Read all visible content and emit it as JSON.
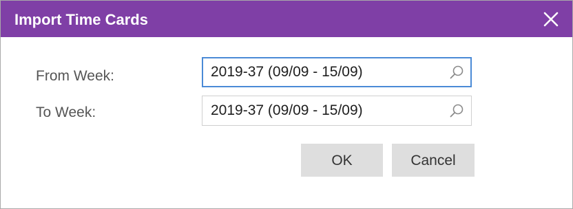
{
  "dialog": {
    "title": "Import Time Cards",
    "colors": {
      "titlebar": "#7f3fa6",
      "focus_border": "#4a8ad6",
      "button_bg": "#dedede"
    }
  },
  "form": {
    "from_week": {
      "label": "From Week:",
      "value": "2019-37 (09/09 - 15/09)",
      "icon": "search-icon",
      "focused": true
    },
    "to_week": {
      "label": "To Week:",
      "value": "2019-37 (09/09 - 15/09)",
      "icon": "search-icon",
      "focused": false
    }
  },
  "buttons": {
    "ok_label": "OK",
    "cancel_label": "Cancel"
  },
  "icons": {
    "close": "close-icon"
  }
}
